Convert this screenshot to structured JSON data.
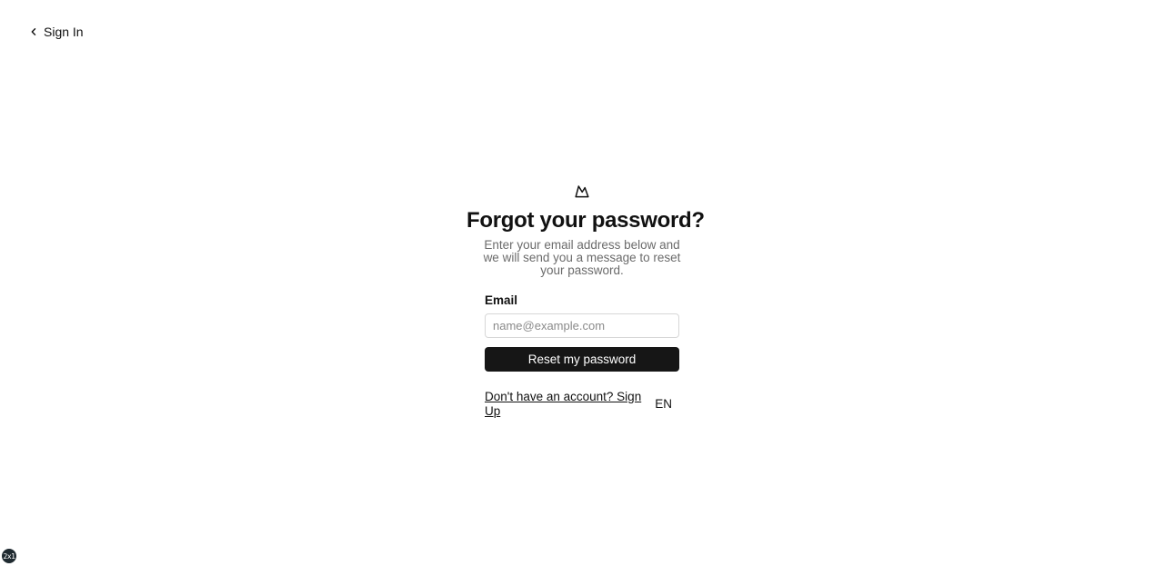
{
  "back_link": {
    "label": "Sign In",
    "icon": "chevron-left-icon"
  },
  "logo": {
    "icon": "mountain-logo-icon"
  },
  "form": {
    "title": "Forgot your password?",
    "subtitle": "Enter your email address below and we will send you a message to reset your password.",
    "email_label": "Email",
    "email_value": "",
    "email_placeholder": "name@example.com",
    "submit_label": "Reset my password"
  },
  "footer": {
    "signup_link": "Don't have an account? Sign Up",
    "language": "EN"
  },
  "debug_badge": {
    "label": "2x1"
  },
  "colors": {
    "button_bg": "#161616",
    "muted_text": "#6b6b6b",
    "input_border": "#d7d7d7"
  }
}
